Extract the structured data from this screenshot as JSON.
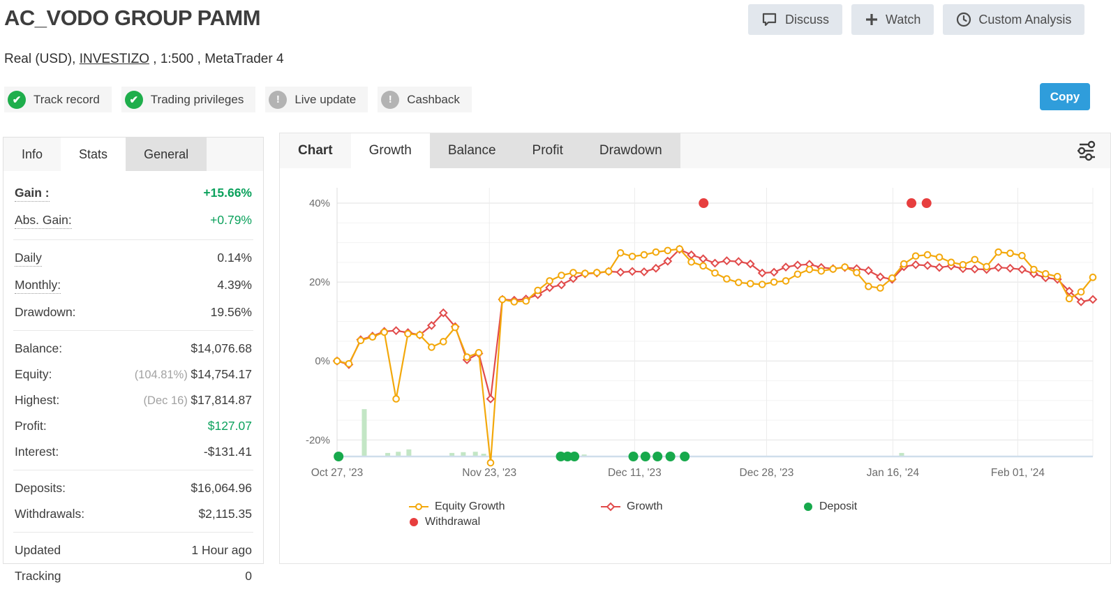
{
  "header": {
    "title": "AC_VODO GROUP PAMM",
    "subtitle": {
      "prefix": "Real (USD), ",
      "broker_link": "INVESTIZO",
      "suffix": " , 1:500 , MetaTrader 4"
    },
    "actions": [
      {
        "label": "Discuss",
        "icon": "discuss-icon"
      },
      {
        "label": "Watch",
        "icon": "plus-icon"
      },
      {
        "label": "Custom Analysis",
        "icon": "clock-icon"
      }
    ],
    "copy_button": "Copy"
  },
  "badges": [
    {
      "label": "Track record",
      "status": "ok"
    },
    {
      "label": "Trading privileges",
      "status": "ok"
    },
    {
      "label": "Live update",
      "status": "attention"
    },
    {
      "label": "Cashback",
      "status": "attention"
    }
  ],
  "stats_panel": {
    "tabs": [
      {
        "label": "Info",
        "state": "plain"
      },
      {
        "label": "Stats",
        "state": "active"
      },
      {
        "label": "General",
        "state": "inactive"
      }
    ],
    "groups": [
      [
        {
          "label": "Gain :",
          "value": "+15.66%",
          "label_bold": true,
          "value_bold": true,
          "value_color": "green",
          "dotted": true
        },
        {
          "label": "Abs. Gain:",
          "value": "+0.79%",
          "value_color": "green",
          "dotted": true
        }
      ],
      [
        {
          "label": "Daily",
          "value": "0.14%",
          "dotted": true
        },
        {
          "label": "Monthly:",
          "value": "4.39%",
          "dotted": true
        },
        {
          "label": "Drawdown:",
          "value": "19.56%"
        }
      ],
      [
        {
          "label": "Balance:",
          "value": "$14,076.68"
        },
        {
          "label": "Equity:",
          "value_prefix": "(104.81%) ",
          "value": "$14,754.17"
        },
        {
          "label": "Highest:",
          "value_prefix": "(Dec 16) ",
          "value": "$17,814.87"
        },
        {
          "label": "Profit:",
          "value": "$127.07",
          "value_color": "green"
        },
        {
          "label": "Interest:",
          "value": "-$131.41"
        }
      ],
      [
        {
          "label": "Deposits:",
          "value": "$16,064.96"
        },
        {
          "label": "Withdrawals:",
          "value": "$2,115.35"
        }
      ],
      [
        {
          "label": "Updated",
          "value": "1 Hour ago"
        },
        {
          "label": "Tracking",
          "value": "0"
        }
      ]
    ]
  },
  "chart_card": {
    "label": "Chart",
    "tabs": [
      {
        "label": "Growth",
        "state": "active"
      },
      {
        "label": "Balance",
        "state": "inactive"
      },
      {
        "label": "Profit",
        "state": "inactive"
      },
      {
        "label": "Drawdown",
        "state": "inactive"
      }
    ],
    "settings_icon": "sliders-icon"
  },
  "chart_data": {
    "type": "line",
    "title": "",
    "x_axis": {
      "tick_labels": [
        "Oct 27, '23",
        "Nov 23, '23",
        "Dec 11, '23",
        "Dec 28, '23",
        "Jan 16, '24",
        "Feb 01, '24"
      ],
      "tick_fractions": [
        0.0,
        0.2015,
        0.3937,
        0.5683,
        0.7354,
        0.9007
      ]
    },
    "y_axis": {
      "unit": "%",
      "range": [
        -24.2,
        43.9
      ],
      "ticks": [
        40,
        20,
        0,
        -20
      ],
      "tick_labels": [
        "40%",
        "20%",
        "0%",
        "-20%"
      ]
    },
    "grid": true,
    "legend_position": "bottom",
    "series": [
      {
        "name": "Equity Growth",
        "color": "#f3a80b",
        "marker": "circle",
        "values": [
          0.0,
          -0.7,
          5.2,
          6.1,
          7.3,
          -9.6,
          6.9,
          6.6,
          3.5,
          4.9,
          8.5,
          1.0,
          2.1,
          -25.8,
          15.6,
          15.0,
          15.2,
          17.9,
          20.3,
          21.7,
          22.4,
          22.2,
          22.4,
          22.7,
          27.4,
          26.5,
          26.9,
          27.6,
          28.0,
          28.4,
          25.1,
          24.1,
          22.3,
          20.8,
          19.9,
          19.6,
          19.4,
          20.0,
          20.3,
          22.0,
          23.2,
          22.8,
          23.3,
          23.8,
          22.4,
          18.9,
          18.5,
          21.0,
          24.6,
          26.6,
          26.9,
          26.3,
          25.0,
          24.4,
          25.7,
          23.9,
          27.6,
          27.3,
          26.7,
          23.2,
          22.1,
          21.4,
          15.8,
          17.5,
          21.2
        ]
      },
      {
        "name": "Growth",
        "color": "#e14b4b",
        "marker": "diamond",
        "values": [
          0.0,
          -0.9,
          5.4,
          6.3,
          7.5,
          7.7,
          7.2,
          6.6,
          9.0,
          12.2,
          8.7,
          0.3,
          1.9,
          -9.6,
          15.6,
          15.4,
          15.7,
          16.8,
          18.6,
          19.3,
          20.9,
          22.1,
          22.3,
          22.7,
          22.5,
          22.7,
          22.6,
          23.5,
          25.3,
          28.3,
          26.9,
          25.9,
          24.8,
          25.4,
          25.2,
          24.6,
          22.3,
          22.5,
          23.8,
          24.3,
          24.5,
          23.7,
          23.4,
          23.7,
          23.4,
          22.9,
          21.3,
          20.7,
          23.9,
          24.4,
          24.2,
          23.7,
          24.1,
          23.4,
          23.3,
          23.2,
          23.7,
          23.5,
          23.2,
          22.1,
          21.1,
          20.7,
          17.7,
          15.0,
          15.6
        ]
      }
    ],
    "events": {
      "deposits": {
        "name": "Deposit",
        "color": "#17a94c",
        "x_fractions": [
          0.002,
          0.296,
          0.305,
          0.314,
          0.392,
          0.408,
          0.424,
          0.441,
          0.46
        ]
      },
      "withdrawals": {
        "name": "Withdrawal",
        "color": "#e73e3e",
        "at_value": 40,
        "x_fractions": [
          0.485,
          0.76,
          0.78
        ]
      }
    },
    "volume_bars": {
      "color": "#c3e6c5",
      "items": [
        {
          "f": 0.036,
          "h": 12.0
        },
        {
          "f": 0.067,
          "h": 0.9
        },
        {
          "f": 0.081,
          "h": 1.2
        },
        {
          "f": 0.095,
          "h": 1.8
        },
        {
          "f": 0.152,
          "h": 0.9
        },
        {
          "f": 0.167,
          "h": 1.1
        },
        {
          "f": 0.183,
          "h": 1.2
        },
        {
          "f": 0.194,
          "h": 0.7
        },
        {
          "f": 0.327,
          "h": 0.5
        },
        {
          "f": 0.747,
          "h": 0.9
        }
      ]
    },
    "legend": [
      {
        "name": "Equity Growth",
        "glyph": "line-circle",
        "color": "#f3a80b",
        "col": 0,
        "row": 0
      },
      {
        "name": "Growth",
        "glyph": "line-diamond",
        "color": "#e14b4b",
        "col": 1,
        "row": 0
      },
      {
        "name": "Deposit",
        "glyph": "dot",
        "color": "#17a94c",
        "col": 2,
        "row": 0
      },
      {
        "name": "Withdrawal",
        "glyph": "dot",
        "color": "#e73e3e",
        "col": 0,
        "row": 1
      }
    ]
  }
}
